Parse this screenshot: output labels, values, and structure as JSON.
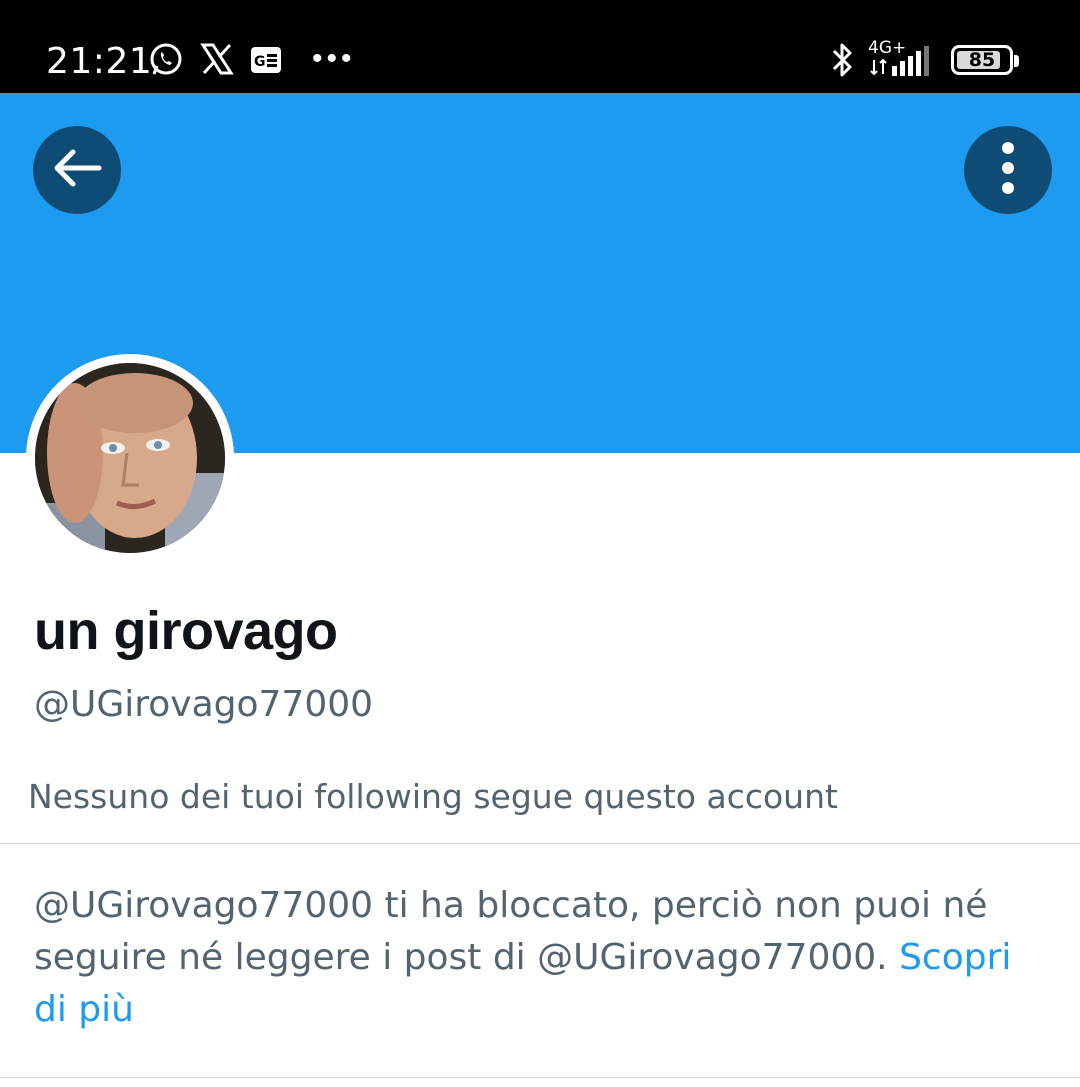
{
  "status_bar": {
    "time": "21:21",
    "notification_icons": [
      "whatsapp-icon",
      "x-icon",
      "news-icon"
    ],
    "more_notifications": "•••",
    "network": "4G+",
    "battery_level": "85",
    "battery_fraction": 0.85
  },
  "profile": {
    "banner_color": "#1d9bf0",
    "display_name": "un girovago",
    "handle": "@UGirovago77000",
    "followers_you_know": "Nessuno dei tuoi following segue questo account"
  },
  "blocked_notice": {
    "message": "@UGirovago77000 ti ha bloccato, perciò non puoi né seguire né leggere i post di @UGirovago77000.",
    "learn_more": "Scopri di più"
  },
  "colors": {
    "accent": "#1d9bf0",
    "text_primary": "#0f1419",
    "text_secondary": "#536471",
    "overlay_button": "#0f4c75"
  }
}
